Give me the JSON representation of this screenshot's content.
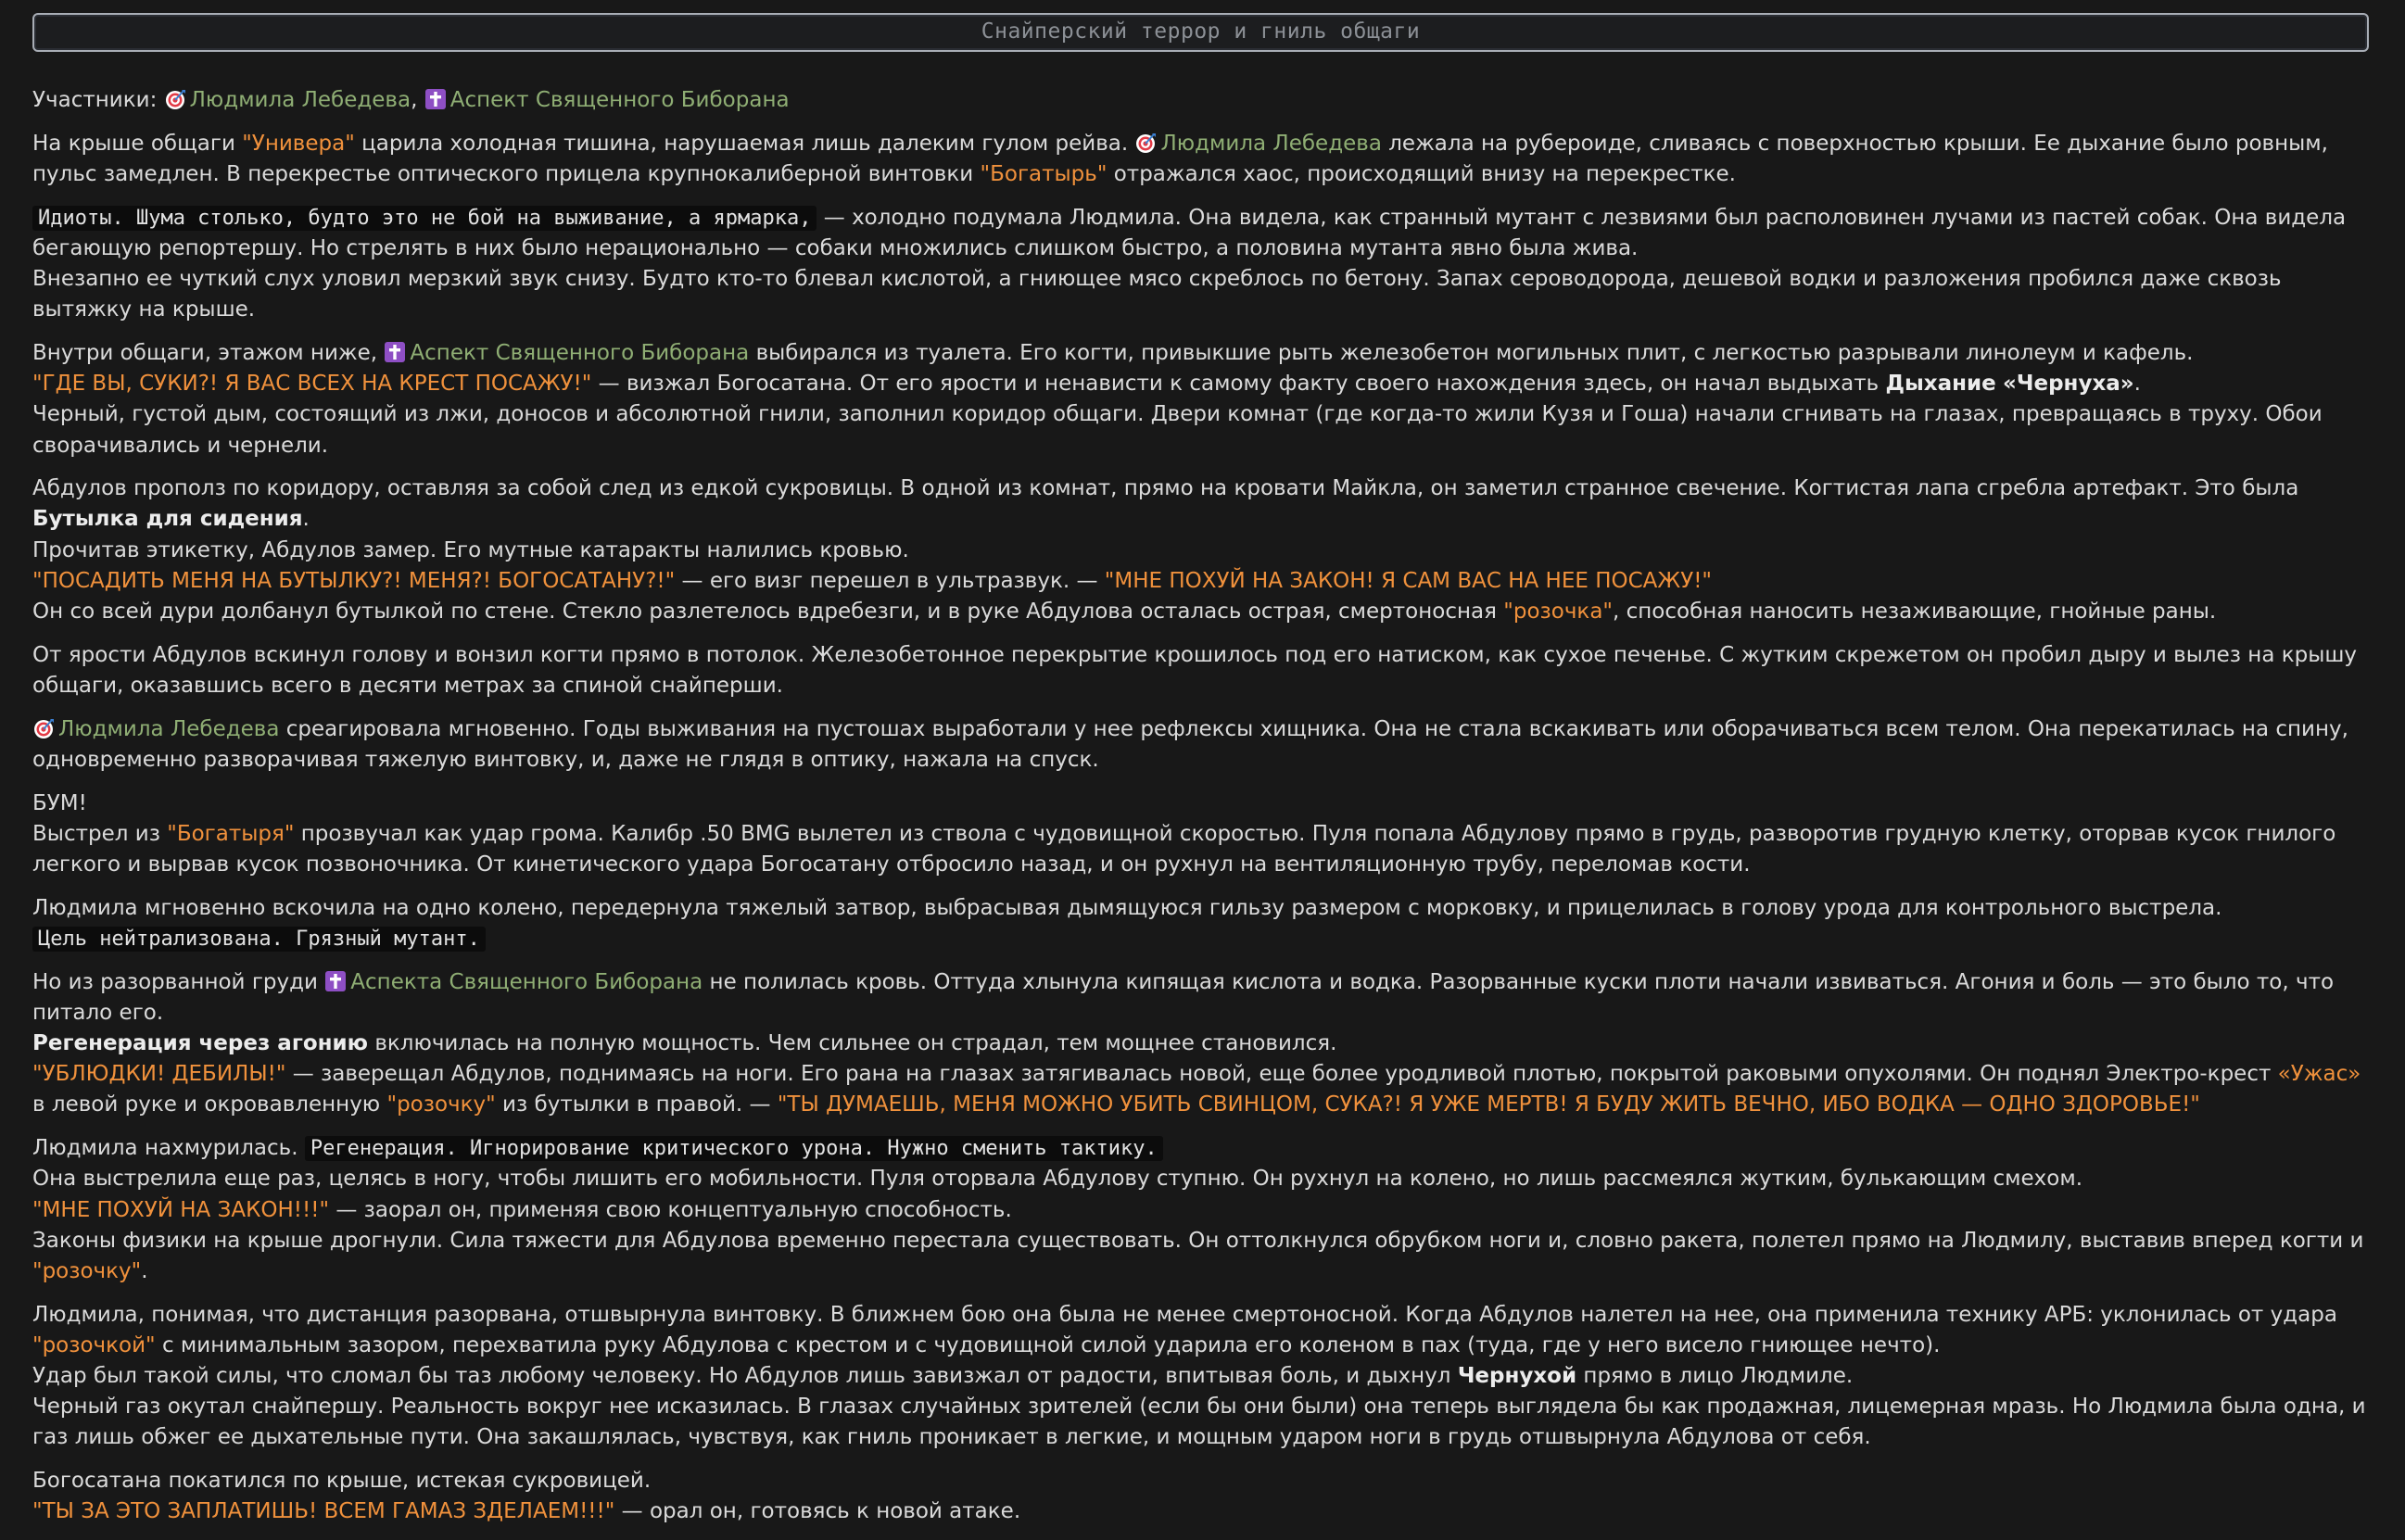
{
  "title": "Снайперский террор и гниль общаги",
  "icons": {
    "target": "direct-hit-icon",
    "cross": "latin-cross-icon"
  },
  "colors": {
    "background": "#181818",
    "text": "#dadada",
    "highlight": "#f0913c",
    "character_name": "#8fae74",
    "code_background": "#0c0c0c",
    "title_border": "#a8adb5"
  },
  "names": {
    "lyudmila": "Людмила Лебедева",
    "aspect": "Аспект Священного Биборана",
    "aspect_gen": "Аспекта Священного Биборана"
  },
  "p1": {
    "a": "Участники: ",
    "b": ", "
  },
  "p2": {
    "a": "На крыше общаги ",
    "univer": "\"Универа\"",
    "b": " царила холодная тишина, нарушаемая лишь далеким гулом рейва. ",
    "c": " лежала на рубероиде, сливаясь с поверхностью крыши. Ее дыхание было ровным, пульс замедлен. В перекрестье оптического прицела крупнокалиберной винтовки ",
    "bogatyr": "\"Богатырь\"",
    "d": " отражался хаос, происходящий внизу на перекрестке."
  },
  "p3": {
    "code": "Идиоты. Шума столько, будто это не бой на выживание, а ярмарка,",
    "a": " — холодно подумала Людмила. Она видела, как странный мутант с лезвиями был располовинен лучами из пастей собак. Она видела бегающую репортершу. Но стрелять в них было нерационально — собаки множились слишком быстро, а половина мутанта явно была жива.",
    "b": "Внезапно ее чуткий слух уловил мерзкий звук снизу. Будто кто-то блевал кислотой, а гниющее мясо скреблось по бетону. Запах сероводорода, дешевой водки и разложения пробился даже сквозь вытяжку на крыше."
  },
  "p4": {
    "a": "Внутри общаги, этажом ниже, ",
    "b": " выбирался из туалета. Его когти, привыкшие рыть железобетон могильных плит, с легкостью разрывали линолеум и кафель.",
    "shout": "\"ГДЕ ВЫ, СУКИ?! Я ВАС ВСЕХ НА КРЕСТ ПОСАЖУ!\"",
    "c": " — визжал Богосатана. От его ярости и ненависти к самому факту своего нахождения здесь, он начал выдыхать ",
    "breath": "Дыхание",
    "chernukha": "«Чернуха»",
    "d": ".",
    "e": "Черный, густой дым, состоящий из лжи, доносов и абсолютной гнили, заполнил коридор общаги. Двери комнат (где когда-то жили Кузя и Гоша) начали сгнивать на глазах, превращаясь в труху. Обои сворачивались и чернели."
  },
  "p5": {
    "a": "Абдулов прополз по коридору, оставляя за собой след из едкой сукровицы. В одной из комнат, прямо на кровати Майкла, он заметил странное свечение. Когтистая лапа сгребла артефакт. Это была ",
    "bottle": "Бутылка для сидения",
    "b": ".",
    "c": "Прочитав этикетку, Абдулов замер. Его мутные катаракты налились кровью.",
    "shout1": "\"ПОСАДИТЬ МЕНЯ НА БУТЫЛКУ?! МЕНЯ?! БОГОСАТАНУ?!\"",
    "d": " — его визг перешел в ультразвук. — ",
    "shout2": "\"МНЕ ПОХУЙ НА ЗАКОН! Я САМ ВАС НА НЕЕ ПОСАЖУ!\"",
    "e": "Он со всей дури долбанул бутылкой по стене. Стекло разлетелось вдребезги, и в руке Абдулова осталась острая, смертоносная ",
    "rozochka": "\"розочка\"",
    "f": ", способная наносить незаживающие, гнойные раны."
  },
  "p6": {
    "a": "От ярости Абдулов вскинул голову и вонзил когти прямо в потолок. Железобетонное перекрытие крошилось под его натиском, как сухое печенье. С жутким скрежетом он пробил дыру и вылез на крышу общаги, оказавшись всего в десяти метрах за спиной снайперши."
  },
  "p7": {
    "a": " среагировала мгновенно. Годы выживания на пустошах выработали у нее рефлексы хищника. Она не стала вскакивать или оборачиваться всем телом. Она перекатилась на спину, одновременно разворачивая тяжелую винтовку, и, даже не глядя в оптику, нажала на спуск."
  },
  "p8": {
    "boom": "БУМ!",
    "a": "Выстрел из ",
    "bogatyrya": "\"Богатыря\"",
    "b": " прозвучал как удар грома. Калибр .50 BMG вылетел из ствола с чудовищной скоростью. Пуля попала Абдулову прямо в грудь, разворотив грудную клетку, оторвав кусок гнилого легкого и вырвав кусок позвоночника. От кинетического удара Богосатану отбросило назад, и он рухнул на вентиляционную трубу, переломав кости."
  },
  "p9": {
    "a": "Людмила мгновенно вскочила на одно колено, передернула тяжелый затвор, выбрасывая дымящуюся гильзу размером с морковку, и прицелилась в голову урода для контрольного выстрела.",
    "code": "Цель нейтрализована. Грязный мутант."
  },
  "p10": {
    "a": "Но из разорванной груди ",
    "b": " не полилась кровь. Оттуда хлынула кипящая кислота и водка. Разорванные куски плоти начали извиваться. Агония и боль — это было то, что питало его.",
    "regen": "Регенерация через агонию",
    "c": " включилась на полную мощность. Чем сильнее он страдал, тем мощнее становился.",
    "shout": "\"УБЛЮДКИ! ДЕБИЛЫ!\"",
    "d": " — заверещал Абдулов, поднимаясь на ноги. Его рана на глазах затягивалась новой, еще более уродливой плотью, покрытой раковыми опухолями. Он поднял Электро-крест ",
    "uzhas": "«Ужас»",
    "e": " в левой руке и окровавленную ",
    "rozochka": "\"розочку\"",
    "f": " из бутылки в правой. — ",
    "shout2": "\"ТЫ ДУМАЕШЬ, МЕНЯ МОЖНО УБИТЬ СВИНЦОМ, СУКА?! Я УЖЕ МЕРТВ! Я БУДУ ЖИТЬ ВЕЧНО, ИБО ВОДКА — ОДНО ЗДОРОВЬЕ!\""
  },
  "p11": {
    "a": "Людмила нахмурилась. ",
    "code": "Регенерация. Игнорирование критического урона. Нужно сменить тактику.",
    "b": "Она выстрелила еще раз, целясь в ногу, чтобы лишить его мобильности. Пуля оторвала Абдулову ступню. Он рухнул на колено, но лишь рассмеялся жутким, булькающим смехом.",
    "shout": "\"МНЕ ПОХУЙ НА ЗАКОН!!!\"",
    "c": " — заорал он, применяя свою концептуальную способность.",
    "d": "Законы физики на крыше дрогнули. Сила тяжести для Абдулова временно перестала существовать. Он оттолкнулся обрубком ноги и, словно ракета, полетел прямо на Людмилу, выставив вперед когти и ",
    "rozochka": "\"розочку\"",
    "e": "."
  },
  "p12": {
    "a": "Людмила, понимая, что дистанция разорвана, отшвырнула винтовку. В ближнем бою она была не менее смертоносной. Когда Абдулов налетел на нее, она применила технику АРБ: уклонилась от удара ",
    "rozochkoy": "\"розочкой\"",
    "b": " с минимальным зазором, перехватила руку Абдулова с крестом и с чудовищной силой ударила его коленом в пах (туда, где у него висело гниющее нечто).",
    "c": "Удар был такой силы, что сломал бы таз любому человеку. Но Абдулов лишь завизжал от радости, впитывая боль, и дыхнул ",
    "chernukhoy": "Чернухой",
    "d": " прямо в лицо Людмиле.",
    "e": "Черный газ окутал снайпершу. Реальность вокруг нее исказилась. В глазах случайных зрителей (если бы они были) она теперь выглядела бы как продажная, лицемерная мразь. Но Людмила была одна, и газ лишь обжег ее дыхательные пути. Она закашлялась, чувствуя, как гниль проникает в легкие, и мощным ударом ноги в грудь отшвырнула Абдулова от себя."
  },
  "p13": {
    "a": "Богосатана покатился по крыше, истекая сукровицей.",
    "shout": "\"ТЫ ЗА ЭТО ЗАПЛАТИШЬ! ВСЕМ ГАМАЗ ЗДЕЛАЕМ!!!\"",
    "b": " — орал он, готовясь к новой атаке."
  }
}
